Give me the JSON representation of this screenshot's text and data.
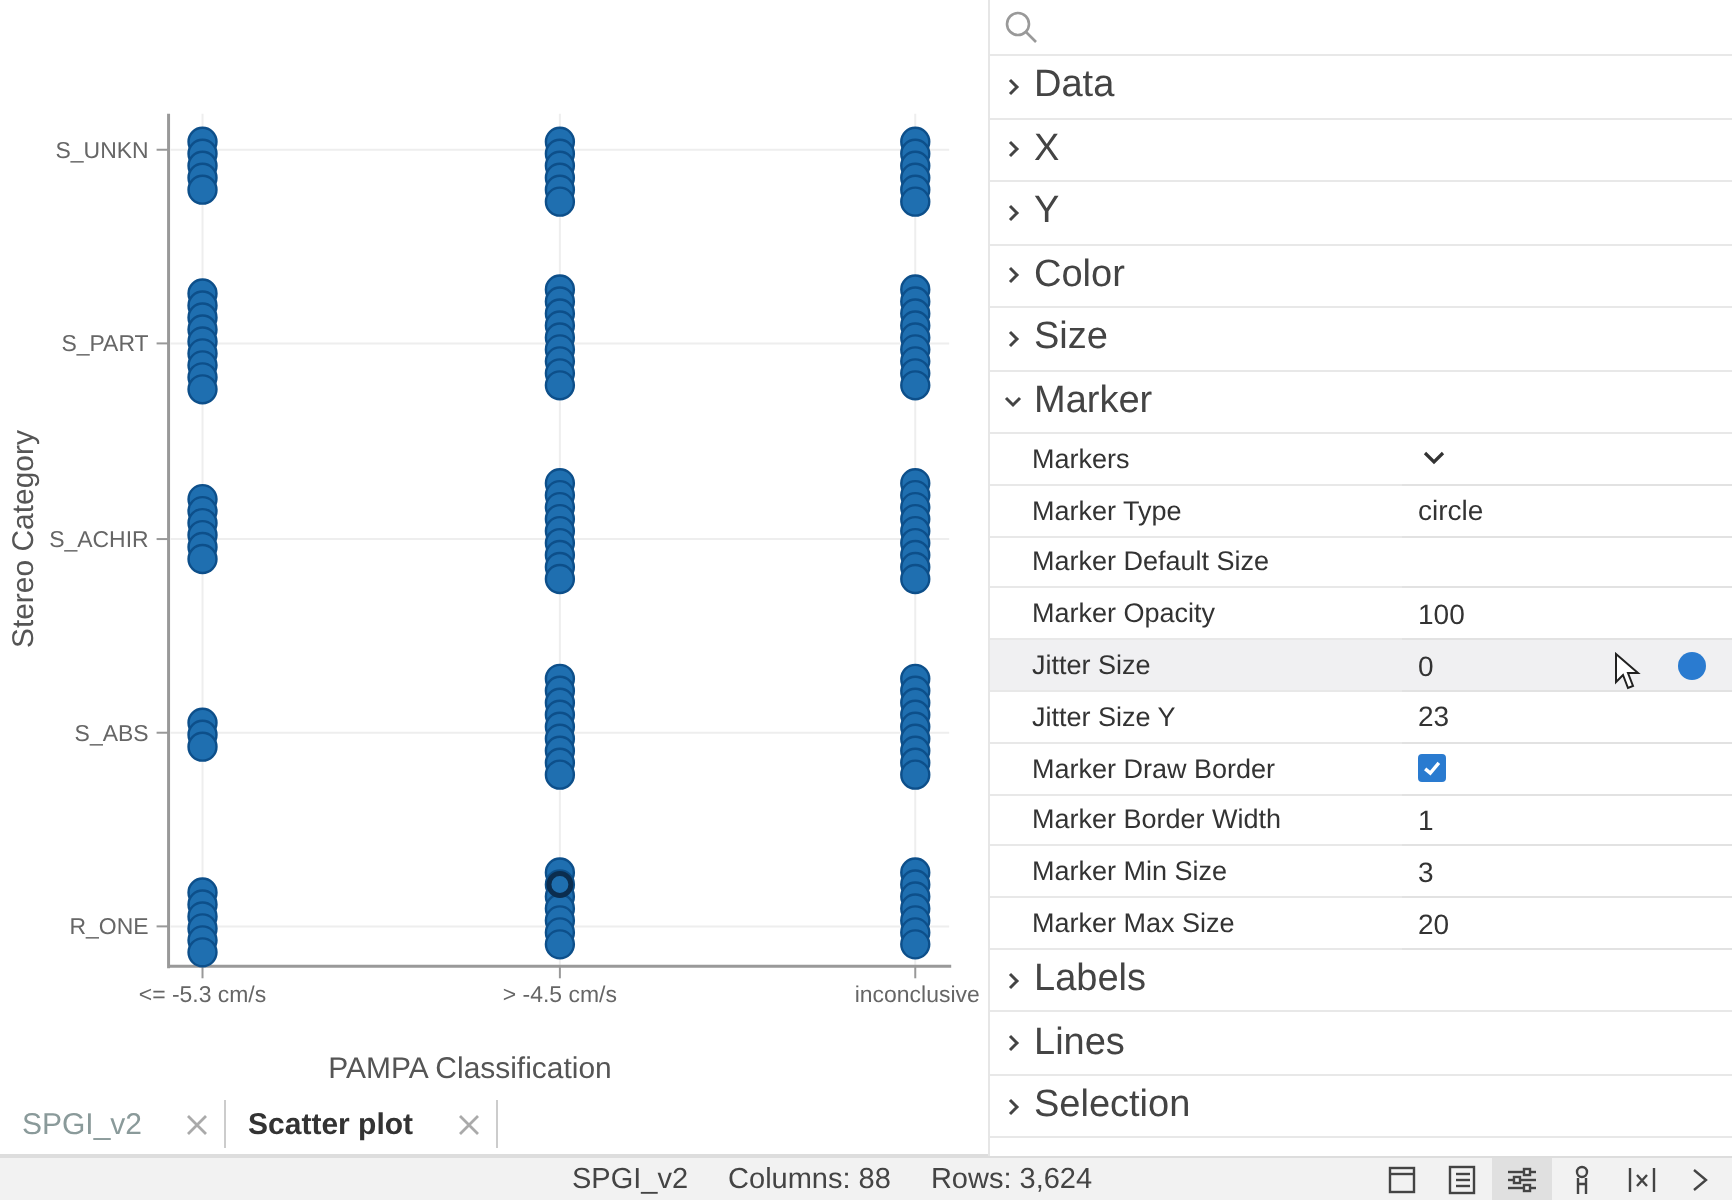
{
  "plot": {
    "ylabel": "Stereo Category",
    "xlabel": "PAMPA Classification",
    "y_ticks": [
      "S_UNKN",
      "S_PART",
      "S_ACHIR",
      "S_ABS",
      "R_ONE"
    ],
    "x_ticks": [
      "<= -5.3 cm/s",
      "> -4.5 cm/s",
      "inconclusive"
    ]
  },
  "tabs": [
    {
      "label": "SPGI_v2",
      "selected": false
    },
    {
      "label": "Scatter plot",
      "selected": true
    }
  ],
  "panel": {
    "sections": [
      {
        "title": "Data",
        "expanded": false
      },
      {
        "title": "X",
        "expanded": false
      },
      {
        "title": "Y",
        "expanded": false
      },
      {
        "title": "Color",
        "expanded": false
      },
      {
        "title": "Size",
        "expanded": false
      },
      {
        "title": "Marker",
        "expanded": true,
        "properties": [
          {
            "label": "Markers",
            "kind": "dropdown",
            "highlighted": false
          },
          {
            "label": "Marker Type",
            "kind": "text",
            "value": "circle",
            "highlighted": false
          },
          {
            "label": "Marker Default Size",
            "kind": "text",
            "highlighted": false
          },
          {
            "label": "Marker Opacity",
            "kind": "text",
            "value": "100",
            "highlighted": false
          },
          {
            "label": "Jitter Size",
            "kind": "text",
            "value": "0",
            "highlighted": true
          },
          {
            "label": "Jitter Size Y",
            "kind": "text",
            "value": "23",
            "highlighted": false
          },
          {
            "label": "Marker Draw Border",
            "kind": "checkbox",
            "checked": true,
            "highlighted": false
          },
          {
            "label": "Marker Border Width",
            "kind": "text",
            "value": "1",
            "highlighted": false
          },
          {
            "label": "Marker Min Size",
            "kind": "text",
            "value": "3",
            "highlighted": false
          },
          {
            "label": "Marker Max Size",
            "kind": "text",
            "value": "20",
            "highlighted": false
          }
        ]
      },
      {
        "title": "Labels",
        "expanded": false
      },
      {
        "title": "Lines",
        "expanded": false
      },
      {
        "title": "Selection",
        "expanded": false
      }
    ]
  },
  "status_bar": {
    "items": [
      "SPGI_v2",
      "Columns: 88",
      "Rows: 3,624"
    ],
    "tools": [
      {
        "kind": "panel",
        "selected": false
      },
      {
        "kind": "list",
        "selected": false
      },
      {
        "kind": "sliders",
        "selected": true
      },
      {
        "kind": "person",
        "selected": false
      },
      {
        "kind": "variable",
        "selected": false
      },
      {
        "kind": "chevron",
        "selected": false
      }
    ]
  }
}
